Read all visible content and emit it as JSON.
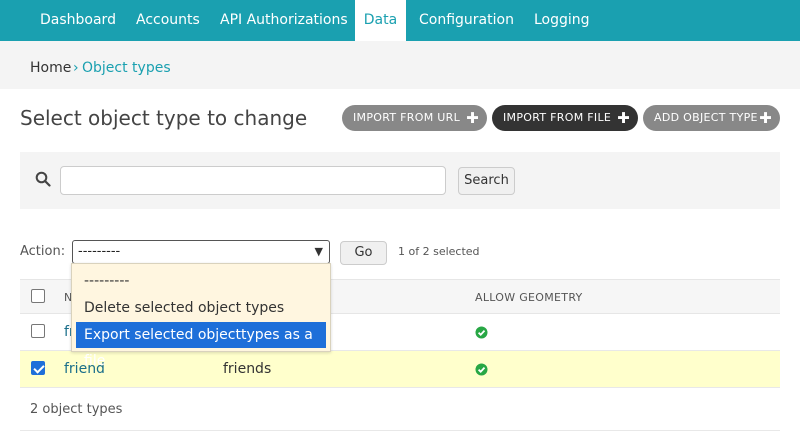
{
  "nav": {
    "tabs": [
      {
        "label": "Dashboard"
      },
      {
        "label": "Accounts"
      },
      {
        "label": "API Authorizations"
      },
      {
        "label": "Data"
      },
      {
        "label": "Configuration"
      },
      {
        "label": "Logging"
      }
    ],
    "active": "Data",
    "accent": "#1aa0b0"
  },
  "breadcrumb": {
    "home": "Home",
    "sep": "›",
    "current": "Object types"
  },
  "page": {
    "title": "Select object type to change"
  },
  "toolbar": {
    "import_url": "IMPORT FROM URL",
    "import_file": "IMPORT FROM FILE",
    "add": "ADD OBJECT TYPE",
    "plus": "✚"
  },
  "search": {
    "value": "",
    "button": "Search",
    "icon": "search-icon"
  },
  "actions": {
    "label": "Action:",
    "selected": "---------",
    "go": "Go",
    "selection_count": "1 of 2 selected",
    "options": [
      "---------",
      "Delete selected object types",
      "Export selected objecttypes as a file"
    ],
    "highlighted_option": "Export selected objecttypes as a file"
  },
  "table": {
    "columns": [
      "N",
      "ALLOW GEOMETRY"
    ],
    "rows": [
      {
        "name": "fr",
        "plural": "",
        "allow_geometry": true,
        "checked": false
      },
      {
        "name": "friend",
        "plural": "friends",
        "allow_geometry": true,
        "checked": true
      }
    ],
    "footer": "2 object types",
    "colors": {
      "check_icon": "#28a745",
      "selected_row": "#ffffcc",
      "select_highlight": "#1e6fd9"
    }
  }
}
